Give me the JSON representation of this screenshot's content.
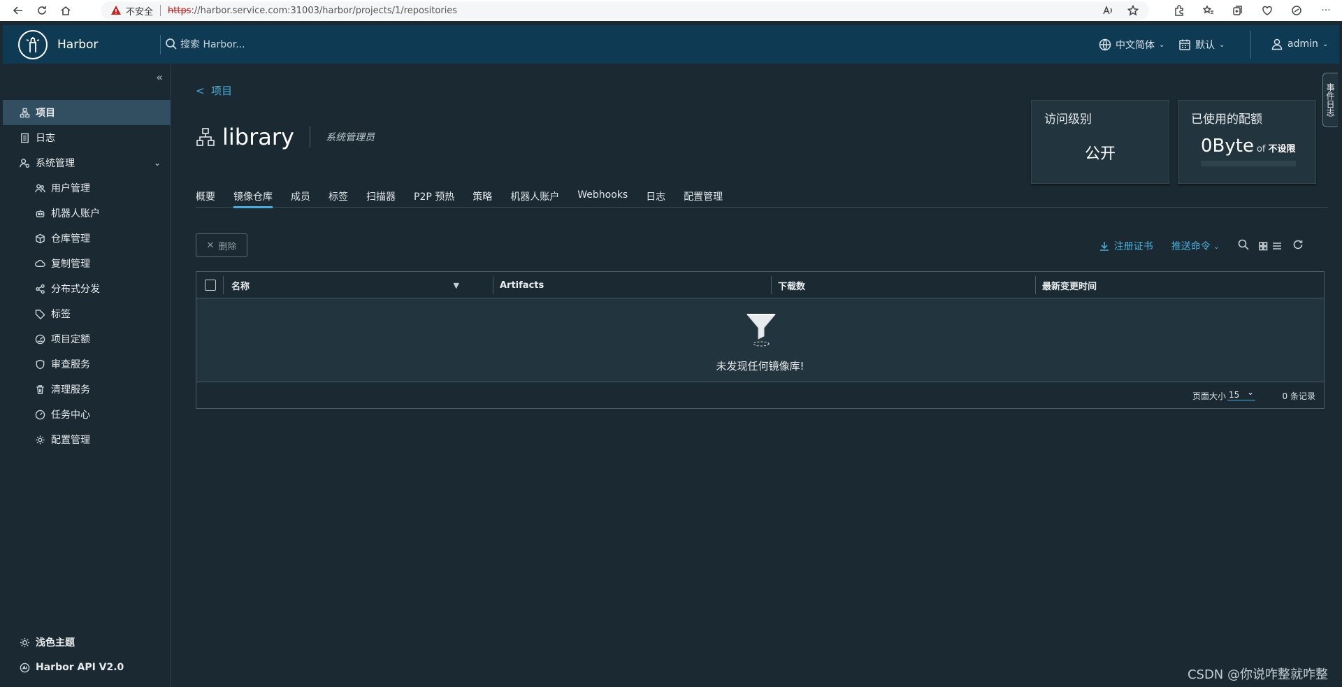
{
  "browser": {
    "insecure_label": "不安全",
    "url_protocol": "https",
    "url_rest": "://harbor.service.com:31003/harbor/projects/1/repositories"
  },
  "header": {
    "app_name": "Harbor",
    "search_placeholder": "搜索 Harbor...",
    "language": "中文简体",
    "theme_select": "默认",
    "user": "admin"
  },
  "sidebar": {
    "items": [
      {
        "label": "项目",
        "icon": "projects-icon"
      },
      {
        "label": "日志",
        "icon": "logs-icon"
      },
      {
        "label": "系统管理",
        "icon": "admin-icon"
      }
    ],
    "sub_items": [
      {
        "label": "用户管理",
        "icon": "users-icon"
      },
      {
        "label": "机器人账户",
        "icon": "robot-icon"
      },
      {
        "label": "仓库管理",
        "icon": "registry-icon"
      },
      {
        "label": "复制管理",
        "icon": "replication-icon"
      },
      {
        "label": "分布式分发",
        "icon": "distribution-icon"
      },
      {
        "label": "标签",
        "icon": "tag-icon"
      },
      {
        "label": "项目定额",
        "icon": "quota-icon"
      },
      {
        "label": "审查服务",
        "icon": "shield-icon"
      },
      {
        "label": "清理服务",
        "icon": "trash-icon"
      },
      {
        "label": "任务中心",
        "icon": "dashboard-icon"
      },
      {
        "label": "配置管理",
        "icon": "gear-icon"
      }
    ],
    "theme_label": "浅色主题",
    "api_label": "Harbor API V2.0"
  },
  "main": {
    "back_label": "项目",
    "project_name": "library",
    "role": "系统管理员",
    "access_card": {
      "title": "访问级别",
      "value": "公开"
    },
    "quota_card": {
      "title": "已使用的配额",
      "value": "0Byte",
      "of": "of",
      "limit": "不设限"
    },
    "tabs": [
      "概要",
      "镜像仓库",
      "成员",
      "标签",
      "扫描器",
      "P2P 预热",
      "策略",
      "机器人账户",
      "Webhooks",
      "日志",
      "配置管理"
    ],
    "active_tab": "镜像仓库",
    "delete_label": "删除",
    "register_cert": "注册证书",
    "push_cmd": "推送命令",
    "columns": [
      "名称",
      "Artifacts",
      "下载数",
      "最新变更时间"
    ],
    "empty_text": "未发现任何镜像库!",
    "page_size_label": "页面大小",
    "page_size": "15",
    "record_count": "0 条记录"
  },
  "right_tab": "事件日志",
  "watermark": "CSDN @你说咋整就咋整"
}
